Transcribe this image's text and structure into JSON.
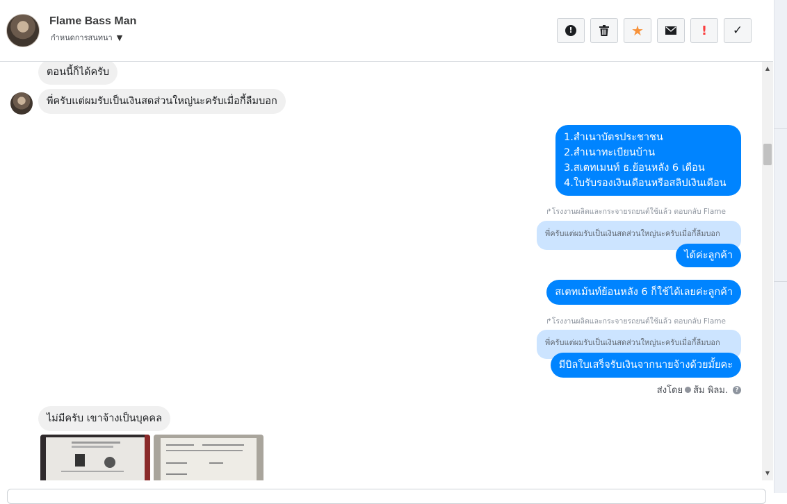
{
  "header": {
    "name": "Flame Bass Man",
    "assign_label": "กำหนดการสนทนา",
    "actions": [
      {
        "icon": "alert-circle-icon",
        "glyph": "!",
        "color": "#1c1e21"
      },
      {
        "icon": "trash-icon",
        "glyph": "🗑",
        "color": "#1c1e21"
      },
      {
        "icon": "star-icon",
        "glyph": "★",
        "color": "#f7923a"
      },
      {
        "icon": "envelope-icon",
        "glyph": "✉",
        "color": "#1c1e21"
      },
      {
        "icon": "exclamation-icon",
        "glyph": "!",
        "color": "#fa3e3e"
      },
      {
        "icon": "check-icon",
        "glyph": "✓",
        "color": "#1c1e21"
      }
    ]
  },
  "messages": {
    "m1": "ตอนนี้ก็ได้ครับ",
    "m2": "พี่ครับแต่ผมรับเป็นเงินสดส่วนใหญ่นะครับเมื่อกี้ลืมบอก",
    "m3_lines": [
      "1.สำเนาบัตรประชาชน",
      "2.สำเนาทะเบียนบ้าน",
      "3.สเตทเมนท์ ธ.ย้อนหลัง 6 เดือน",
      "4.ใบรับรองเงินเดือนหรือสลิปเงินเดือน"
    ],
    "reply_note": "โรงงานผลิตและกระจายรถยนต์ใช้แล้ว ตอบกลับ Flame",
    "quote_text": "พี่ครับแต่ผมรับเป็นเงินสดส่วนใหญ่นะครับเมื่อกี้ลืมบอก",
    "m4": "ได้ค่ะลูกค้า",
    "m5": "สเตทเม้นท์ย้อนหลัง 6 ก็ใช้ได้เลยค่ะลูกค้า",
    "m6": "มีบิลใบเสร็จรับเงินจากนายจ้างด้วยมั้ยคะ",
    "sent_by_label": "ส่งโดย",
    "sent_by_name": "ส้ม พิลม.",
    "m7": "ไม่มีครับ เขาจ้างเป็นบุคคล"
  },
  "colors": {
    "outgoing": "#0084ff",
    "incoming": "#f0f0f0",
    "quote": "#cce4ff"
  }
}
